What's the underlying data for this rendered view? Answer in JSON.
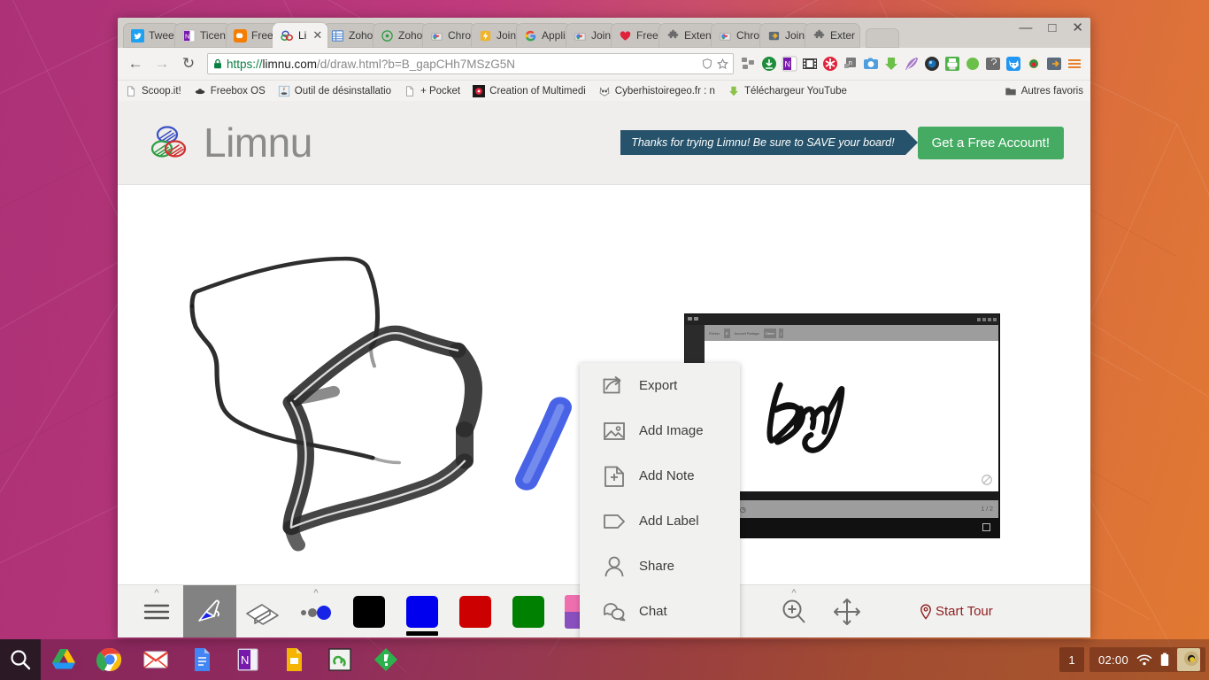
{
  "desktop": {
    "taskbar": {
      "launchers": [
        {
          "name": "search-icon",
          "label": "Search"
        },
        {
          "name": "google-drive-icon",
          "label": "Google Drive"
        },
        {
          "name": "google-chrome-icon",
          "label": "Google Chrome"
        },
        {
          "name": "gmail-icon",
          "label": "Gmail"
        },
        {
          "name": "google-docs-icon",
          "label": "Google Docs"
        },
        {
          "name": "onenote-icon",
          "label": "OneNote"
        },
        {
          "name": "google-slides-icon",
          "label": "Google Slides"
        },
        {
          "name": "sync-app-icon",
          "label": "Sync"
        },
        {
          "name": "feedly-icon",
          "label": "Feedly"
        }
      ],
      "workspace": "1",
      "clock": "02:00",
      "tray_icons": [
        "wifi-icon",
        "battery-icon",
        "user-avatar"
      ]
    }
  },
  "browser": {
    "tabs": [
      {
        "label": "Twee",
        "favicon": "twitter-icon",
        "active": false
      },
      {
        "label": "Ticen",
        "favicon": "onenote-icon",
        "active": false
      },
      {
        "label": "Free",
        "favicon": "blogger-icon",
        "active": false
      },
      {
        "label": "Li",
        "favicon": "limnu-icon",
        "active": true
      },
      {
        "label": "Zoho",
        "favicon": "zoho-sheet-icon",
        "active": false
      },
      {
        "label": "Zoho",
        "favicon": "zoho-circle-icon",
        "active": false
      },
      {
        "label": "Chro",
        "favicon": "chrome-store-icon",
        "active": false
      },
      {
        "label": "Join",
        "favicon": "join-lightning-icon",
        "active": false
      },
      {
        "label": "Appli",
        "favicon": "google-icon",
        "active": false
      },
      {
        "label": "Join",
        "favicon": "chrome-store-icon",
        "active": false
      },
      {
        "label": "Free",
        "favicon": "heart-icon",
        "active": false
      },
      {
        "label": "Exten",
        "favicon": "puzzle-icon",
        "active": false
      },
      {
        "label": "Chro",
        "favicon": "chrome-store-icon",
        "active": false
      },
      {
        "label": "Join",
        "favicon": "join-exit-icon",
        "active": false
      },
      {
        "label": "Exter",
        "favicon": "puzzle-icon",
        "active": false
      }
    ],
    "window_controls": {
      "minimize": "—",
      "maximize": "□",
      "close": "✕"
    },
    "nav": {
      "back": "←",
      "forward": "→",
      "reload": "↻"
    },
    "omnibox": {
      "lock": "lock-icon",
      "scheme": "https://",
      "host": "limnu.com",
      "path": "/d/draw.html?b=B_gapCHh7MSzG5N",
      "full_url": "https://limnu.com/d/draw.html?b=B_gapCHh7MSzG5N",
      "shield": "shield-icon",
      "star": "star-icon"
    },
    "extensions": [
      "grid-icon",
      "download-green-icon",
      "onenote-icon",
      "filmstrip-icon",
      "asterisk-red-icon",
      "note-gray-icon",
      "camera-blue-icon",
      "download-arrow-green-icon",
      "feather-purple-icon",
      "camera-dark-icon",
      "print-green-icon",
      "circle-green-icon",
      "speech-gray-icon",
      "fox-blue-icon",
      "avocode-icon",
      "exit-door-icon",
      "menu-icon"
    ],
    "bookmarks": [
      {
        "label": "Scoop.it!",
        "icon": "page-icon"
      },
      {
        "label": "Freebox OS",
        "icon": "freebox-icon"
      },
      {
        "label": "Outil de désinstallatio",
        "icon": "java-icon"
      },
      {
        "label": "+ Pocket",
        "icon": "page-icon"
      },
      {
        "label": "Creation of Multimedi",
        "icon": "multimedia-icon"
      },
      {
        "label": "Cyberhistoiregeo.fr : n",
        "icon": "owl-icon"
      },
      {
        "label": "Téléchargeur YouTube",
        "icon": "download-green-icon"
      }
    ],
    "other_bookmarks": {
      "label": "Autres favoris",
      "icon": "folder-icon"
    }
  },
  "limnu": {
    "logo_text": "Limnu",
    "promo_banner": "Thanks for trying Limnu! Be sure to SAVE your board!",
    "free_account_button": "Get a Free Account!",
    "popup_menu": [
      {
        "label": "Export",
        "icon": "export-icon"
      },
      {
        "label": "Add Image",
        "icon": "image-icon"
      },
      {
        "label": "Add Note",
        "icon": "note-plus-icon"
      },
      {
        "label": "Add Label",
        "icon": "tag-icon"
      },
      {
        "label": "Share",
        "icon": "person-icon"
      },
      {
        "label": "Chat",
        "icon": "chat-bubbles-icon"
      }
    ],
    "toolbar": {
      "menu": {
        "name": "hamburger-menu",
        "has_chevron": true
      },
      "marker": {
        "name": "marker-tool",
        "selected": true
      },
      "eraser": {
        "name": "eraser-tool",
        "selected": false
      },
      "brush_size": {
        "name": "brush-size-tool",
        "has_chevron": true
      },
      "colors": [
        {
          "name": "color-black",
          "hex": "#000000",
          "active": false
        },
        {
          "name": "color-blue",
          "hex": "#0000ee",
          "active": true
        },
        {
          "name": "color-red",
          "hex": "#cc0000",
          "active": false
        },
        {
          "name": "color-green",
          "hex": "#008000",
          "active": false
        }
      ],
      "palette": {
        "name": "color-palette",
        "has_chevron": true,
        "quadrants": [
          "#ef6fae",
          "#fbe07c",
          "#8a4fbe",
          "#15a2a2"
        ]
      },
      "add_content": {
        "name": "add-content-button",
        "active": true
      },
      "fit_screen": {
        "name": "fit-to-screen-button"
      },
      "zoom": {
        "name": "zoom-button",
        "has_chevron": true
      },
      "pan": {
        "name": "pan-button"
      },
      "start_tour": {
        "label": "Start Tour",
        "icon": "location-pin-icon",
        "color": "#8e1f1f"
      }
    },
    "board": {
      "strokes": [
        {
          "name": "black-thin-stroke",
          "color": "#1a1a1a"
        },
        {
          "name": "black-thick-stroke",
          "color": "#2a2a2a"
        },
        {
          "name": "blue-thick-stroke",
          "color": "#4060e8"
        }
      ],
      "pasted_image": {
        "name": "pasted-screenshot",
        "handwriting": "Bmy",
        "page_indicator": "1 / 2"
      }
    }
  }
}
